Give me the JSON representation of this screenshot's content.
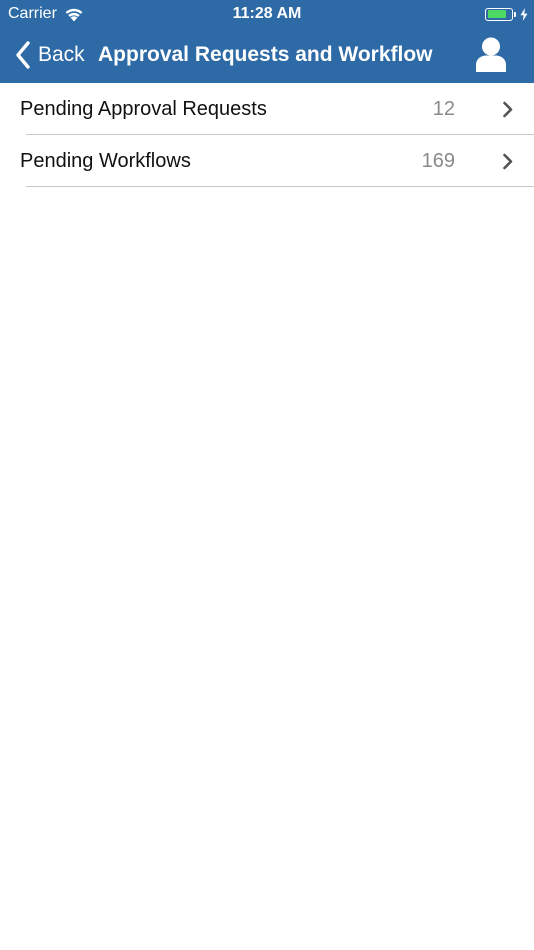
{
  "status_bar": {
    "carrier": "Carrier",
    "time": "11:28 AM",
    "wifi_icon": "wifi-icon",
    "battery_icon": "battery-icon",
    "battery_level": 0.85,
    "charging_icon": "charging-bolt-icon"
  },
  "nav_bar": {
    "back_label": "Back",
    "back_icon": "chevron-left-icon",
    "title": "Approval Requests and Workflow",
    "profile_icon": "user-icon",
    "background_color": "#2e6aa6"
  },
  "list": {
    "items": [
      {
        "label": "Pending Approval Requests",
        "count": "12",
        "icon": "chevron-right-icon"
      },
      {
        "label": "Pending Workflows",
        "count": "169",
        "icon": "chevron-right-icon"
      }
    ]
  }
}
